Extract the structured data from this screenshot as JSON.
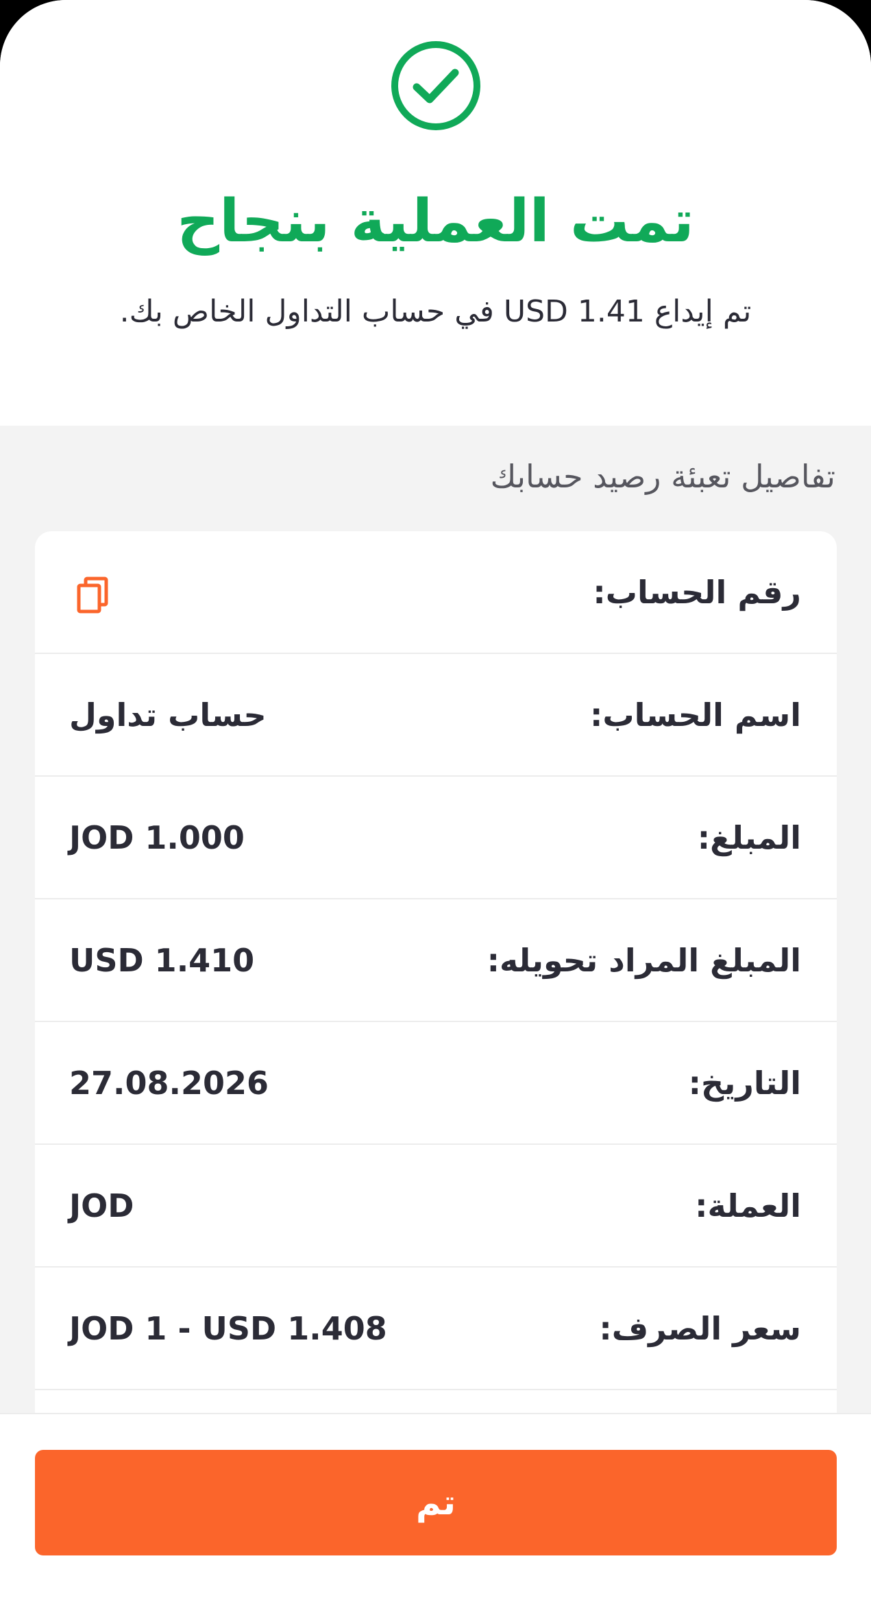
{
  "colors": {
    "success": "#10a958",
    "accent": "#fb652b",
    "text": "#2b2b36"
  },
  "header": {
    "icon": "check-circle-icon",
    "title": "تمت العملية بنجاح",
    "subtitle": "تم إيداع USD 1.41 في حساب التداول الخاص بك."
  },
  "details": {
    "section_label": "تفاصيل تعبئة رصيد حسابك",
    "account_number": {
      "label": "رقم الحساب:",
      "icon": "copy-icon"
    },
    "account_name": {
      "label": "اسم الحساب:",
      "value": "حساب تداول"
    },
    "amount": {
      "label": "المبلغ:",
      "value": "JOD 1.000"
    },
    "converted_amount": {
      "label": "المبلغ المراد تحويله:",
      "value": "USD 1.410"
    },
    "date": {
      "label": "التاريخ:",
      "value": "27.08.2026"
    },
    "currency": {
      "label": "العملة:",
      "value": "JOD"
    },
    "exchange_rate": {
      "label": "سعر الصرف:",
      "value": "JOD 1 - USD 1.408"
    }
  },
  "footer": {
    "done_label": "تم"
  }
}
